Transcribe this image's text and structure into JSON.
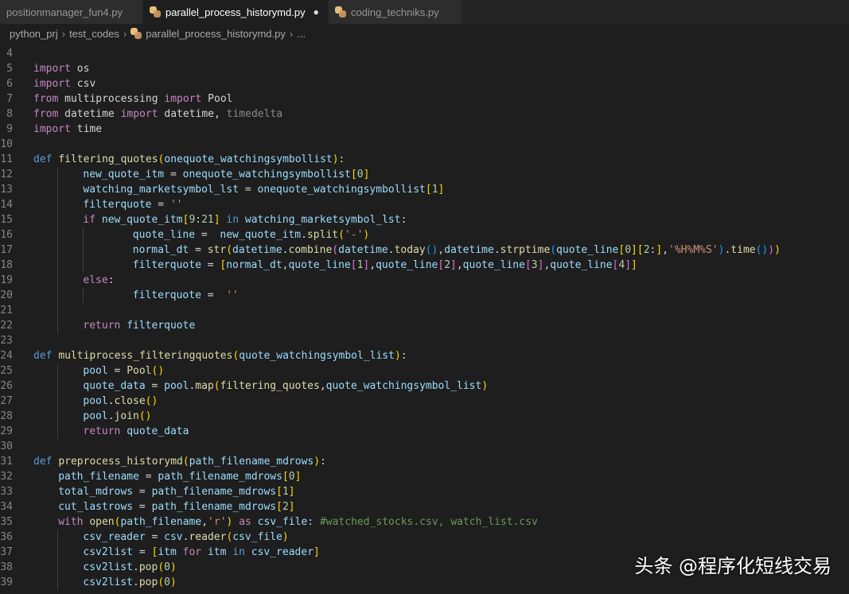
{
  "tabs": [
    {
      "label": "positionmanager_fun4.py",
      "active": false,
      "icon": "python-icon"
    },
    {
      "label": "parallel_process_historymd.py",
      "active": true,
      "modified": true,
      "icon": "python-icon",
      "modified_marker": "●"
    },
    {
      "label": "coding_techniks.py",
      "active": false,
      "icon": "python-icon"
    }
  ],
  "breadcrumb": {
    "items": [
      "python_prj",
      "test_codes",
      "parallel_process_historymd.py",
      "..."
    ],
    "separator": "›"
  },
  "code_lines": [
    {
      "n": "4",
      "indent": 0,
      "tokens": []
    },
    {
      "n": "5",
      "indent": 0,
      "tokens": [
        [
          "ctl",
          "import"
        ],
        [
          "",
          " os"
        ]
      ]
    },
    {
      "n": "6",
      "indent": 0,
      "tokens": [
        [
          "ctl",
          "import"
        ],
        [
          "",
          " csv"
        ]
      ]
    },
    {
      "n": "7",
      "indent": 0,
      "tokens": [
        [
          "ctl",
          "from"
        ],
        [
          "",
          " multiprocessing "
        ],
        [
          "ctl",
          "import"
        ],
        [
          "",
          " Pool"
        ]
      ]
    },
    {
      "n": "8",
      "indent": 0,
      "tokens": [
        [
          "ctl",
          "from"
        ],
        [
          "",
          " datetime "
        ],
        [
          "ctl",
          "import"
        ],
        [
          "",
          " datetime, "
        ],
        [
          "dim",
          "timedelta"
        ]
      ]
    },
    {
      "n": "9",
      "indent": 0,
      "tokens": [
        [
          "ctl",
          "import"
        ],
        [
          "",
          " time"
        ]
      ]
    },
    {
      "n": "10",
      "indent": 0,
      "tokens": []
    },
    {
      "n": "11",
      "indent": 0,
      "tokens": [
        [
          "kw",
          "def"
        ],
        [
          "",
          " "
        ],
        [
          "fn",
          "filtering_quotes"
        ],
        [
          "b1",
          "("
        ],
        [
          "var",
          "onequote_watchingsymbollist"
        ],
        [
          "b1",
          ")"
        ],
        [
          "",
          ":"
        ]
      ]
    },
    {
      "n": "12",
      "indent": 1,
      "tokens": [
        [
          "var",
          "new_quote_itm"
        ],
        [
          "",
          " = "
        ],
        [
          "var",
          "onequote_watchingsymbollist"
        ],
        [
          "b1",
          "["
        ],
        [
          "num",
          "0"
        ],
        [
          "b1",
          "]"
        ]
      ]
    },
    {
      "n": "13",
      "indent": 1,
      "tokens": [
        [
          "var",
          "watching_marketsymbol_lst"
        ],
        [
          "",
          " = "
        ],
        [
          "var",
          "onequote_watchingsymbollist"
        ],
        [
          "b1",
          "["
        ],
        [
          "num",
          "1"
        ],
        [
          "b1",
          "]"
        ]
      ]
    },
    {
      "n": "14",
      "indent": 1,
      "tokens": [
        [
          "var",
          "filterquote"
        ],
        [
          "",
          " = "
        ],
        [
          "str",
          "''"
        ]
      ]
    },
    {
      "n": "15",
      "indent": 1,
      "tokens": [
        [
          "ctl",
          "if"
        ],
        [
          "",
          " "
        ],
        [
          "var",
          "new_quote_itm"
        ],
        [
          "b1",
          "["
        ],
        [
          "num",
          "9"
        ],
        [
          "",
          ":"
        ],
        [
          "num",
          "21"
        ],
        [
          "b1",
          "]"
        ],
        [
          "",
          " "
        ],
        [
          "kw",
          "in"
        ],
        [
          "",
          " "
        ],
        [
          "var",
          "watching_marketsymbol_lst"
        ],
        [
          "",
          ":"
        ]
      ]
    },
    {
      "n": "16",
      "indent": 2,
      "tokens": [
        [
          "var",
          "quote_line"
        ],
        [
          "",
          " =  "
        ],
        [
          "var",
          "new_quote_itm"
        ],
        [
          "",
          "."
        ],
        [
          "fn",
          "split"
        ],
        [
          "b1",
          "("
        ],
        [
          "str",
          "'-'"
        ],
        [
          "b1",
          ")"
        ]
      ]
    },
    {
      "n": "17",
      "indent": 2,
      "tokens": [
        [
          "var",
          "normal_dt"
        ],
        [
          "",
          " = "
        ],
        [
          "fn",
          "str"
        ],
        [
          "b1",
          "("
        ],
        [
          "var",
          "datetime"
        ],
        [
          "",
          "."
        ],
        [
          "fn",
          "combine"
        ],
        [
          "b2",
          "("
        ],
        [
          "var",
          "datetime"
        ],
        [
          "",
          "."
        ],
        [
          "fn",
          "today"
        ],
        [
          "b3",
          "()"
        ],
        [
          "",
          ","
        ],
        [
          "var",
          "datetime"
        ],
        [
          "",
          "."
        ],
        [
          "fn",
          "strptime"
        ],
        [
          "b3",
          "("
        ],
        [
          "var",
          "quote_line"
        ],
        [
          "b1",
          "["
        ],
        [
          "num",
          "0"
        ],
        [
          "b1",
          "]"
        ],
        [
          "b1",
          "["
        ],
        [
          "num",
          "2"
        ],
        [
          "",
          ":"
        ],
        [
          "b1",
          "]"
        ],
        [
          "",
          ","
        ],
        [
          "str",
          "'%H%M%S'"
        ],
        [
          "b3",
          ")"
        ],
        [
          "",
          "."
        ],
        [
          "fn",
          "time"
        ],
        [
          "b3",
          "()"
        ],
        [
          "b2",
          ")"
        ],
        [
          "b1",
          ")"
        ]
      ]
    },
    {
      "n": "18",
      "indent": 2,
      "tokens": [
        [
          "var",
          "filterquote"
        ],
        [
          "",
          " = "
        ],
        [
          "b1",
          "["
        ],
        [
          "var",
          "normal_dt"
        ],
        [
          "",
          ","
        ],
        [
          "var",
          "quote_line"
        ],
        [
          "b2",
          "["
        ],
        [
          "num",
          "1"
        ],
        [
          "b2",
          "]"
        ],
        [
          "",
          ","
        ],
        [
          "var",
          "quote_line"
        ],
        [
          "b2",
          "["
        ],
        [
          "num",
          "2"
        ],
        [
          "b2",
          "]"
        ],
        [
          "",
          ","
        ],
        [
          "var",
          "quote_line"
        ],
        [
          "b2",
          "["
        ],
        [
          "num",
          "3"
        ],
        [
          "b2",
          "]"
        ],
        [
          "",
          ","
        ],
        [
          "var",
          "quote_line"
        ],
        [
          "b2",
          "["
        ],
        [
          "num",
          "4"
        ],
        [
          "b2",
          "]"
        ],
        [
          "b1",
          "]"
        ]
      ]
    },
    {
      "n": "19",
      "indent": 1,
      "tokens": [
        [
          "ctl",
          "else"
        ],
        [
          "",
          ":"
        ]
      ]
    },
    {
      "n": "20",
      "indent": 2,
      "tokens": [
        [
          "var",
          "filterquote"
        ],
        [
          "",
          " =  "
        ],
        [
          "str",
          "''"
        ]
      ]
    },
    {
      "n": "21",
      "indent": 1,
      "tokens": []
    },
    {
      "n": "22",
      "indent": 1,
      "tokens": [
        [
          "ctl",
          "return"
        ],
        [
          "",
          " "
        ],
        [
          "var",
          "filterquote"
        ]
      ]
    },
    {
      "n": "23",
      "indent": 0,
      "tokens": []
    },
    {
      "n": "24",
      "indent": 0,
      "tokens": [
        [
          "kw",
          "def"
        ],
        [
          "",
          " "
        ],
        [
          "fn",
          "multiprocess_filteringquotes"
        ],
        [
          "b1",
          "("
        ],
        [
          "var",
          "quote_watchingsymbol_list"
        ],
        [
          "b1",
          ")"
        ],
        [
          "",
          ":"
        ]
      ]
    },
    {
      "n": "25",
      "indent": 1,
      "tokens": [
        [
          "var",
          "pool"
        ],
        [
          "",
          " = "
        ],
        [
          "fn",
          "Pool"
        ],
        [
          "b1",
          "()"
        ]
      ]
    },
    {
      "n": "26",
      "indent": 1,
      "tokens": [
        [
          "var",
          "quote_data"
        ],
        [
          "",
          " = "
        ],
        [
          "var",
          "pool"
        ],
        [
          "",
          "."
        ],
        [
          "fn",
          "map"
        ],
        [
          "b1",
          "("
        ],
        [
          "fn",
          "filtering_quotes"
        ],
        [
          "",
          ","
        ],
        [
          "var",
          "quote_watchingsymbol_list"
        ],
        [
          "b1",
          ")"
        ]
      ]
    },
    {
      "n": "27",
      "indent": 1,
      "tokens": [
        [
          "var",
          "pool"
        ],
        [
          "",
          "."
        ],
        [
          "fn",
          "close"
        ],
        [
          "b1",
          "()"
        ]
      ]
    },
    {
      "n": "28",
      "indent": 1,
      "tokens": [
        [
          "var",
          "pool"
        ],
        [
          "",
          "."
        ],
        [
          "fn",
          "join"
        ],
        [
          "b1",
          "()"
        ]
      ]
    },
    {
      "n": "29",
      "indent": 1,
      "tokens": [
        [
          "ctl",
          "return"
        ],
        [
          "",
          " "
        ],
        [
          "var",
          "quote_data"
        ]
      ]
    },
    {
      "n": "30",
      "indent": 0,
      "tokens": []
    },
    {
      "n": "31",
      "indent": 0,
      "tokens": [
        [
          "kw",
          "def"
        ],
        [
          "",
          " "
        ],
        [
          "fn",
          "preprocess_historymd"
        ],
        [
          "b1",
          "("
        ],
        [
          "var",
          "path_filename_mdrows"
        ],
        [
          "b1",
          ")"
        ],
        [
          "",
          ":"
        ]
      ]
    },
    {
      "n": "32",
      "indent": 0.5,
      "tokens": [
        [
          "var",
          "path_filename"
        ],
        [
          "",
          " = "
        ],
        [
          "var",
          "path_filename_mdrows"
        ],
        [
          "b1",
          "["
        ],
        [
          "num",
          "0"
        ],
        [
          "b1",
          "]"
        ]
      ]
    },
    {
      "n": "33",
      "indent": 0.5,
      "tokens": [
        [
          "var",
          "total_mdrows"
        ],
        [
          "",
          " = "
        ],
        [
          "var",
          "path_filename_mdrows"
        ],
        [
          "b1",
          "["
        ],
        [
          "num",
          "1"
        ],
        [
          "b1",
          "]"
        ]
      ]
    },
    {
      "n": "34",
      "indent": 0.5,
      "tokens": [
        [
          "var",
          "cut_lastrows"
        ],
        [
          "",
          " = "
        ],
        [
          "var",
          "path_filename_mdrows"
        ],
        [
          "b1",
          "["
        ],
        [
          "num",
          "2"
        ],
        [
          "b1",
          "]"
        ]
      ]
    },
    {
      "n": "35",
      "indent": 0.5,
      "tokens": [
        [
          "ctl",
          "with"
        ],
        [
          "",
          " "
        ],
        [
          "fn",
          "open"
        ],
        [
          "b1",
          "("
        ],
        [
          "var",
          "path_filename"
        ],
        [
          "",
          ","
        ],
        [
          "str",
          "'r'"
        ],
        [
          "b1",
          ")"
        ],
        [
          "",
          " "
        ],
        [
          "ctl",
          "as"
        ],
        [
          "",
          " "
        ],
        [
          "var",
          "csv_file"
        ],
        [
          "",
          ": "
        ],
        [
          "cmt",
          "#watched_stocks.csv, watch_list.csv"
        ]
      ]
    },
    {
      "n": "36",
      "indent": 1,
      "tokens": [
        [
          "var",
          "csv_reader"
        ],
        [
          "",
          " = "
        ],
        [
          "var",
          "csv"
        ],
        [
          "",
          "."
        ],
        [
          "fn",
          "reader"
        ],
        [
          "b1",
          "("
        ],
        [
          "var",
          "csv_file"
        ],
        [
          "b1",
          ")"
        ]
      ]
    },
    {
      "n": "37",
      "indent": 1,
      "tokens": [
        [
          "var",
          "csv2list"
        ],
        [
          "",
          " = "
        ],
        [
          "b1",
          "["
        ],
        [
          "var",
          "itm"
        ],
        [
          "",
          " "
        ],
        [
          "ctl",
          "for"
        ],
        [
          "",
          " "
        ],
        [
          "var",
          "itm"
        ],
        [
          "",
          " "
        ],
        [
          "kw",
          "in"
        ],
        [
          "",
          " "
        ],
        [
          "var",
          "csv_reader"
        ],
        [
          "b1",
          "]"
        ]
      ]
    },
    {
      "n": "38",
      "indent": 1,
      "tokens": [
        [
          "var",
          "csv2list"
        ],
        [
          "",
          "."
        ],
        [
          "fn",
          "pop"
        ],
        [
          "b1",
          "("
        ],
        [
          "num",
          "0"
        ],
        [
          "b1",
          ")"
        ]
      ]
    },
    {
      "n": "39",
      "indent": 1,
      "tokens": [
        [
          "var",
          "csv2list"
        ],
        [
          "",
          "."
        ],
        [
          "fn",
          "pop"
        ],
        [
          "b1",
          "("
        ],
        [
          "num",
          "0"
        ],
        [
          "b1",
          ")"
        ]
      ]
    }
  ],
  "watermark": "头条 @程序化短线交易",
  "colors": {
    "background": "#1e1e1e",
    "tabbar": "#252526",
    "keyword": "#569cd6",
    "control": "#c586c0",
    "function": "#dcdcaa",
    "variable": "#9cdcfe",
    "string": "#ce9178",
    "number": "#b5cea8",
    "comment": "#6a9955"
  }
}
